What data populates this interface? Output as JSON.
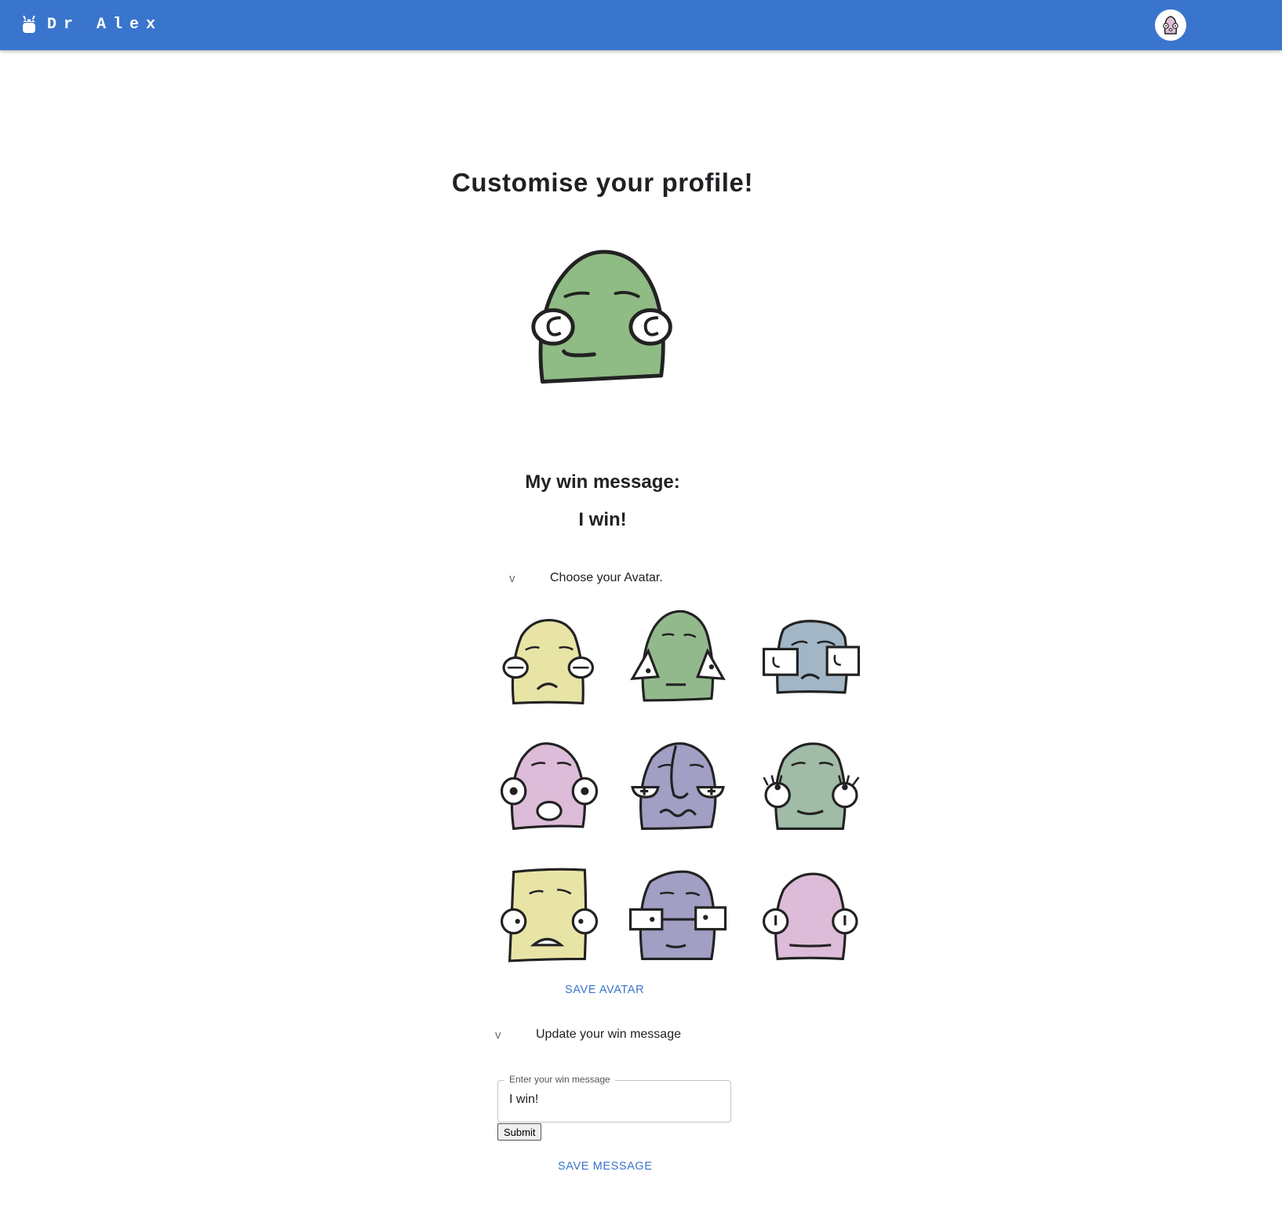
{
  "appbar": {
    "brand_name": "Dr Alex",
    "brand_icon": "robot-icon",
    "profile_icon": "avatar-icon"
  },
  "page": {
    "title": "Customise your profile!"
  },
  "win_message": {
    "label": "My win message:",
    "value": "I win!"
  },
  "avatar_section": {
    "toggle_glyph": "v",
    "title": "Choose your Avatar.",
    "save_label": "SAVE AVATAR",
    "current_avatar_color": "#8fbb84",
    "options": [
      {
        "name": "avatar-yellow-round-eyes",
        "color": "#e8e4a6"
      },
      {
        "name": "avatar-green-triangle-eyes",
        "color": "#92b98c"
      },
      {
        "name": "avatar-blue-square-eyes",
        "color": "#a2b6c6"
      },
      {
        "name": "avatar-pink-surprised",
        "color": "#dcbcd8"
      },
      {
        "name": "avatar-purple-wavy-mouth",
        "color": "#a19fc4"
      },
      {
        "name": "avatar-teal-lashes",
        "color": "#a0bba6"
      },
      {
        "name": "avatar-yellow-square-frown",
        "color": "#e8e4a6"
      },
      {
        "name": "avatar-purple-square-eyes",
        "color": "#a19fc4"
      },
      {
        "name": "avatar-pink-calm",
        "color": "#dcbcd8"
      }
    ]
  },
  "message_section": {
    "toggle_glyph": "v",
    "title": "Update your win message",
    "field_label": "Enter your win message",
    "field_value": "I win!",
    "submit_label": "Submit",
    "save_label": "SAVE MESSAGE"
  },
  "colors": {
    "appbar": "#3a75cd",
    "link": "#3a75cd"
  }
}
